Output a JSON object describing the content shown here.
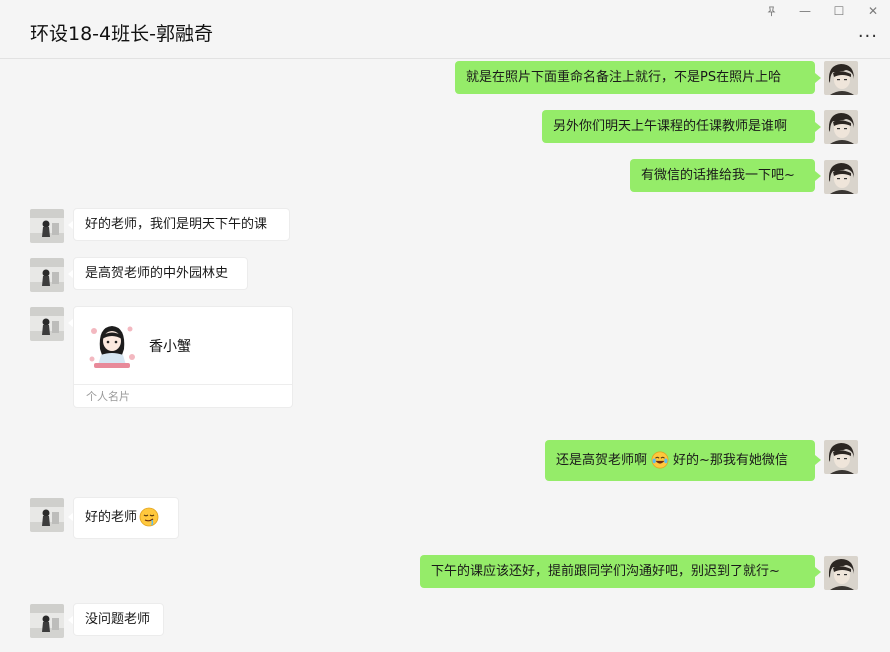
{
  "window": {
    "title": "环设18-4班长-郭融奇",
    "controls": {
      "pin": "pin-icon",
      "minimize": "—",
      "maximize": "☐",
      "close": "✕"
    },
    "more_label": "···"
  },
  "colors": {
    "outgoing_bubble": "#95ec69",
    "incoming_bubble": "#ffffff",
    "background": "#f5f5f5"
  },
  "messages": [
    {
      "direction": "out",
      "text": "就是在照片下面重命名备注上就行，不是PS在照片上哈"
    },
    {
      "direction": "out",
      "text": "另外你们明天上午课程的任课教师是谁啊"
    },
    {
      "direction": "out",
      "text": "有微信的话推给我一下吧~"
    },
    {
      "direction": "in",
      "text": "好的老师，我们是明天下午的课"
    },
    {
      "direction": "in",
      "text": "是高贺老师的中外园林史"
    },
    {
      "direction": "in",
      "type": "contact-card",
      "name": "香小蟹",
      "footer": "个人名片"
    },
    {
      "direction": "out",
      "text_before": "还是高贺老师啊",
      "emoji": "laughing-tears-emoji",
      "text_after": "好的~那我有她微信"
    },
    {
      "direction": "in",
      "text": "好的老师",
      "emoji": "drooling-emoji"
    },
    {
      "direction": "out",
      "text": "下午的课应该还好，提前跟同学们沟通好吧，别迟到了就行~"
    },
    {
      "direction": "in",
      "text": "没问题老师"
    }
  ]
}
